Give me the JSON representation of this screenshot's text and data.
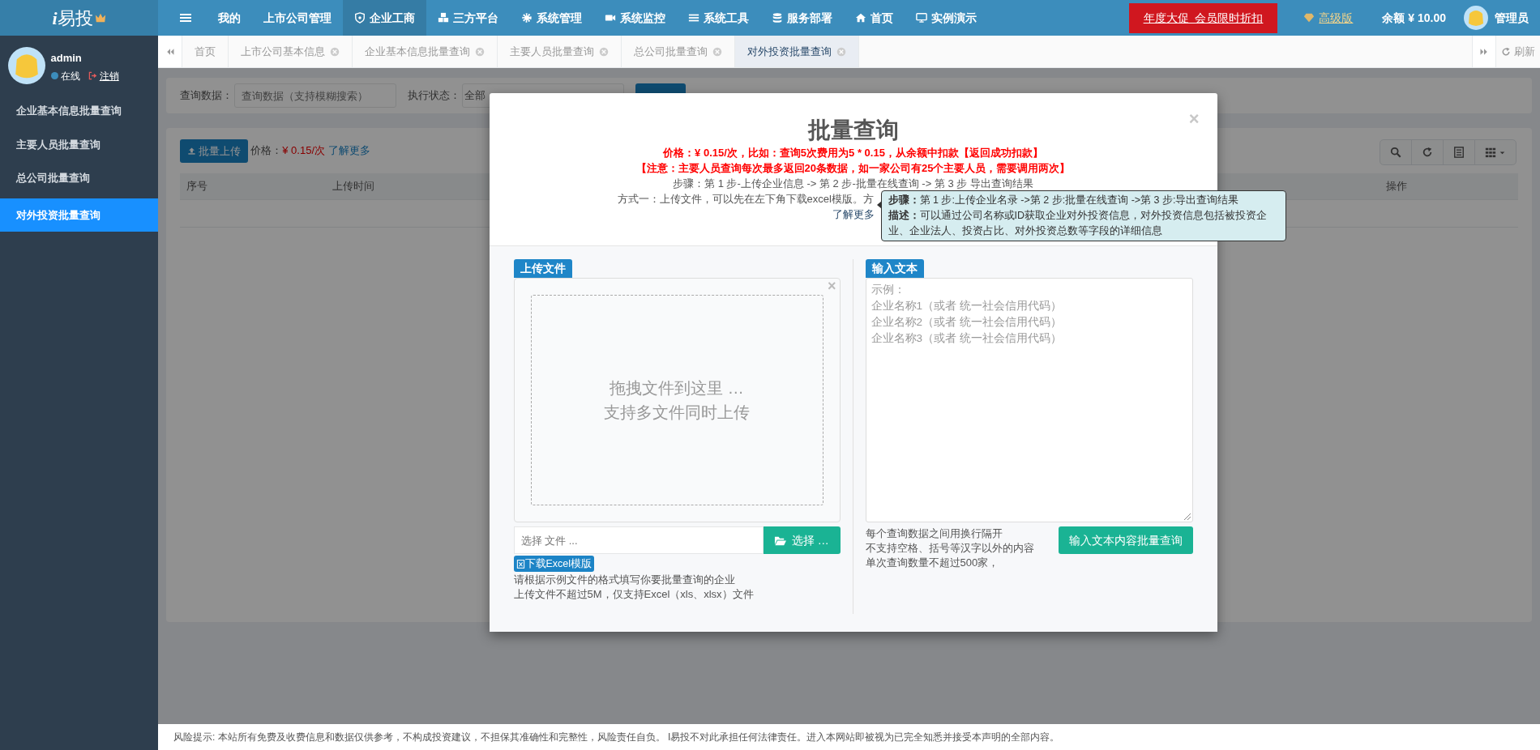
{
  "logo": {
    "mark": "i",
    "name": "易投"
  },
  "navbar": {
    "items": [
      {
        "label": "我的",
        "selected": false
      },
      {
        "label": "上市公司管理",
        "selected": false
      },
      {
        "label": "企业工商",
        "selected": true
      },
      {
        "label": "三方平台",
        "selected": false
      },
      {
        "label": "系统管理",
        "selected": false
      },
      {
        "label": "系统监控",
        "selected": false
      },
      {
        "label": "系统工具",
        "selected": false
      },
      {
        "label": "服务部署",
        "selected": false
      },
      {
        "label": "首页",
        "selected": false
      },
      {
        "label": "实例演示",
        "selected": false
      }
    ],
    "promo": "年度大促  会员限时折扣",
    "edition": "高级版",
    "balance": "余额 ¥ 10.00",
    "user": "管理员"
  },
  "sidebar": {
    "user": {
      "name": "admin",
      "status": "在线",
      "logout": "注销"
    },
    "items": [
      {
        "label": "企业基本信息批量查询",
        "selected": false
      },
      {
        "label": "主要人员批量查询",
        "selected": false
      },
      {
        "label": "总公司批量查询",
        "selected": false
      },
      {
        "label": "对外投资批量查询",
        "selected": true
      }
    ]
  },
  "tabs": [
    {
      "label": "首页",
      "closable": false,
      "selected": false
    },
    {
      "label": "上市公司基本信息",
      "closable": true,
      "selected": false
    },
    {
      "label": "企业基本信息批量查询",
      "closable": true,
      "selected": false
    },
    {
      "label": "主要人员批量查询",
      "closable": true,
      "selected": false
    },
    {
      "label": "总公司批量查询",
      "closable": true,
      "selected": false
    },
    {
      "label": "对外投资批量查询",
      "closable": true,
      "selected": true
    }
  ],
  "refresh": "刷新",
  "search_form": {
    "fields": [
      {
        "kind": "input",
        "label": "查询数据：",
        "placeholder": "查询数据（支持模糊搜索）"
      },
      {
        "kind": "select",
        "label": "执行状态：",
        "value": "全部"
      }
    ]
  },
  "toolbar": {
    "upload_button": "批量上传",
    "price_label": "价格：",
    "price": "¥ 0.15/次",
    "more_link": "了解更多"
  },
  "table": {
    "columns": [
      "序号",
      "上传时间",
      "操作"
    ]
  },
  "modal": {
    "title": "批量查询",
    "close": "×",
    "notes": [
      {
        "kind": "warning",
        "text": "价格：¥ 0.15/次，比如：查询5次费用为5 * 0.15，从余额中扣款【返回成功扣款】"
      },
      {
        "kind": "warning",
        "text": "【注意：主要人员查询每次最多返回20条数据，如一家公司有25个主要人员，需要调用两次】"
      },
      {
        "kind": "plain",
        "text": "步骤：第 1 步-上传企业信息 -> 第 2 步-批量在线查询 -> 第 3 步 导出查询结果"
      },
      {
        "kind": "partial",
        "text": "方式一：上传文件，可以先在左下角下载excel模版。方"
      }
    ],
    "more_link": "了解更多",
    "popover": {
      "lines": [
        "**步骤：**第 1 步:上传企业名录 ->第 2 步:批量在线查询 ->第 3 步:导出查询结果",
        "**描述：**可以通过公司名称或ID获取企业对外投资信息，对外投资信息包括被投资企业、企业法人、投资占比、对外投资总数等字段的详细信息"
      ]
    },
    "upload": {
      "badge": "上传文件",
      "close": "×",
      "drop_text": [
        "拖拽文件到这里 …",
        "支持多文件同时上传"
      ],
      "file_placeholder": "选择 文件 ...",
      "browse_button": "选择 …",
      "template_button": "下载Excel模版",
      "hints": [
        "请根据示例文件的格式填写你要批量查询的企业",
        "上传文件不超过5M，仅支持Excel（xls、xlsx）文件"
      ]
    },
    "text_input": {
      "badge": "输入文本",
      "placeholder": [
        "示例：",
        "企业名称1（或者 统一社会信用代码）",
        "企业名称2（或者 统一社会信用代码）",
        "企业名称3（或者 统一社会信用代码）"
      ],
      "hints": [
        "每个查询数据之间用换行隔开",
        "不支持空格、括号等汉字以外的内容",
        "单次查询数量不超过500家，"
      ],
      "submit_button": "输入文本内容批量查询"
    }
  },
  "footer": "风险提示: 本站所有免费及收费信息和数据仅供参考，不构成投资建议，不担保其准确性和完整性，风险责任自负。 I易投不对此承担任何法律责任。进入本网站即被视为已完全知悉并接受本声明的全部内容。"
}
